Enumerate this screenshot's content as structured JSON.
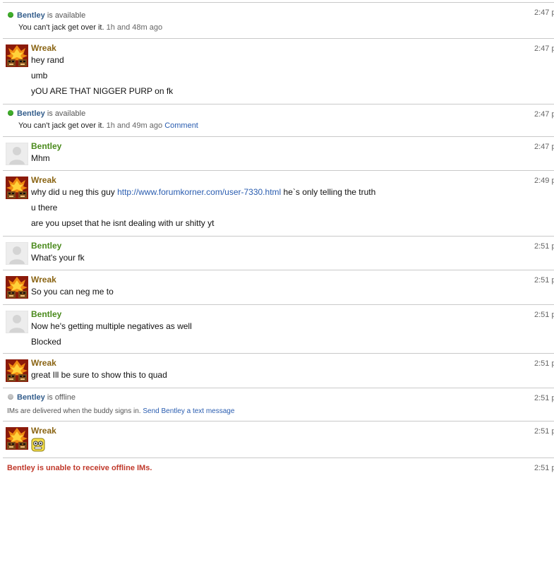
{
  "status1": {
    "name": "Bentley",
    "state": "is available",
    "message": "You can't jack get over it.",
    "ago": "1h and 48m ago",
    "time": "2:47 p"
  },
  "msg1": {
    "sender": "Wreak",
    "time": "2:47 p",
    "lines": [
      "hey rand",
      "umb",
      "yOU ARE THAT NIGGER PURP on fk"
    ]
  },
  "status2": {
    "name": "Bentley",
    "state": "is available",
    "message": "You can't jack get over it.",
    "ago": "1h and 49m ago",
    "comment": "Comment",
    "time": "2:47 p"
  },
  "msg2": {
    "sender": "Bentley",
    "time": "2:47 p",
    "lines": [
      "Mhm"
    ]
  },
  "msg3": {
    "sender": "Wreak",
    "time": "2:49 p",
    "line1_pre": "why did u neg this guy",
    "line1_link": "http://www.forumkorner.com/user-7330.html",
    "line1_post": "he`s only telling the truth",
    "lines": [
      "u there",
      "are you upset that he isnt dealing with ur shitty yt"
    ]
  },
  "msg4": {
    "sender": "Bentley",
    "time": "2:51 p",
    "lines": [
      "What's your fk"
    ]
  },
  "msg5": {
    "sender": "Wreak",
    "time": "2:51 p",
    "lines": [
      "So you can neg me to"
    ]
  },
  "msg6": {
    "sender": "Bentley",
    "time": "2:51 p",
    "lines": [
      "Now he's getting multiple negatives as well",
      "Blocked"
    ]
  },
  "msg7": {
    "sender": "Wreak",
    "time": "2:51 p",
    "lines": [
      "great Ill be sure to show this to quad"
    ]
  },
  "status3": {
    "name": "Bentley",
    "state": "is offline",
    "info": "IMs are delivered when the buddy signs in.",
    "send": "Send Bentley a text message",
    "time": "2:51 p"
  },
  "msg8": {
    "sender": "Wreak",
    "time": "2:51 p",
    "emoticon": "smiley-emoticon"
  },
  "error": {
    "text": "Bentley is unable to receive offline IMs.",
    "time": "2:51 p"
  },
  "colors": {
    "wreak_name": "#8a6413",
    "bentley_name": "#4a8a1c",
    "link": "#2a5db0",
    "error": "#c0392b",
    "online": "#3fae2a",
    "offline": "#c4c4c4"
  }
}
